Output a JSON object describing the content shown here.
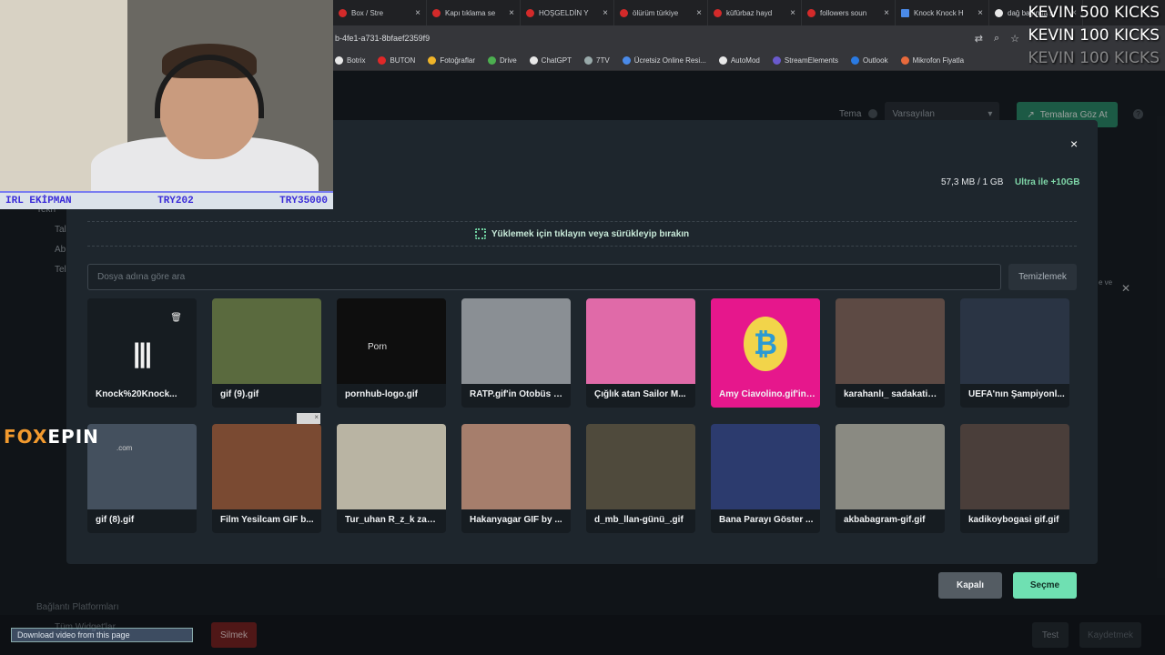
{
  "browser": {
    "tabs": [
      {
        "label": "Box / Stre",
        "type": "red"
      },
      {
        "label": "Kapı tıklama se",
        "type": "red"
      },
      {
        "label": "HOŞGELDİN Y",
        "type": "red"
      },
      {
        "label": "ölürüm türkiye",
        "type": "red"
      },
      {
        "label": "küfürbaz hayd",
        "type": "red"
      },
      {
        "label": "followers soun",
        "type": "red"
      },
      {
        "label": "Knock Knock H",
        "type": "doc"
      },
      {
        "label": "dağ başında sı",
        "type": "g"
      }
    ],
    "address": "b-4fe1-a731-8bfaef2359f9",
    "bookmarks": [
      "Botrix",
      "BUTON",
      "Fotoğraflar",
      "Drive",
      "ChatGPT",
      "7TV",
      "Ücretsiz Online Resi...",
      "AutoMod",
      "StreamElements",
      "Outlook",
      "Mikrofon Fiyatla"
    ]
  },
  "app": {
    "theme_label": "Tema",
    "theme_value": "Varsayılan",
    "themes_button": "Temalara Göz At",
    "leftnav": [
      "Tekn",
      "Tal",
      "Ab",
      "Tel"
    ],
    "side_text": "e ve",
    "bottom_links": [
      "Bağlantı Platformları",
      "Tüm Widget'lar"
    ],
    "delete_button": "Silmek",
    "test_button": "Test",
    "save_button": "Kaydetmek",
    "download_bar": "Download video from this page"
  },
  "modal": {
    "close_glyph": "×",
    "storage": "57,3 MB / 1 GB",
    "upgrade": "Ultra ile +10GB",
    "dropzone_text": "Yüklemek için tıklayın veya sürükleyip bırakın",
    "search_placeholder": "Dosya adına göre ara",
    "clear_button": "Temizlemek",
    "files": [
      {
        "name": "Knock%20Knock...",
        "kind": "audio",
        "thumb": "#161c21"
      },
      {
        "name": "gif (9).gif",
        "kind": "image",
        "thumb": "#5a6a3e"
      },
      {
        "name": "pornhub-logo.gif",
        "kind": "logo",
        "thumb": "#0e0e0e"
      },
      {
        "name": "RATP.gif'in Otobüs B...",
        "kind": "image",
        "thumb": "#8a8f94"
      },
      {
        "name": "Çığlık atan Sailor M...",
        "kind": "image",
        "thumb": "#e06aa8"
      },
      {
        "name": "Amy Ciavolino.gif'in ...",
        "kind": "bitcoin",
        "thumb": "#e6178c"
      },
      {
        "name": "karahanlı_ sadakatin...",
        "kind": "image",
        "thumb": "#5d4a44"
      },
      {
        "name": "UEFA'nın Şampiyonl...",
        "kind": "image",
        "thumb": "#2a3444"
      },
      {
        "name": "gif (8).gif",
        "kind": "image",
        "thumb": "#44505e"
      },
      {
        "name": "Film Yesilcam GIF b...",
        "kind": "image",
        "thumb": "#7a4a32"
      },
      {
        "name": "Tur_uhan R_z_k zam...",
        "kind": "image",
        "thumb": "#b9b4a3"
      },
      {
        "name": "Hakanyagar GIF by ...",
        "kind": "image",
        "thumb": "#a67e6c"
      },
      {
        "name": "d_mb_llan-günü_.gif",
        "kind": "image",
        "thumb": "#4f4a3c"
      },
      {
        "name": "Bana Parayı Göster ...",
        "kind": "image",
        "thumb": "#2c3b6e"
      },
      {
        "name": "akbabagram-gif.gif",
        "kind": "image",
        "thumb": "#8a8a82"
      },
      {
        "name": "kadikoybogasi gif.gif",
        "kind": "image",
        "thumb": "#4a3e3a"
      }
    ],
    "pornhub_text": "Porn",
    "off_button": "Kapalı",
    "choose_button": "Seçme"
  },
  "overlay": {
    "ticker": [
      "IRL EKİPMAN",
      "TRY202",
      "TRY35000"
    ],
    "kicks": [
      "KEVIN  500 KICKS",
      "KEVIN  100 KICKS",
      "KEVIN  100 KICKS"
    ],
    "brand_a": "FOX",
    "brand_b": "EPIN",
    "brand_sub": ".com",
    "ad_close": "×"
  },
  "icons": {
    "trash": "trash-icon",
    "close": "close-icon",
    "upload": "upload-icon",
    "help": "help-icon",
    "chevron": "chevron-down-icon"
  }
}
